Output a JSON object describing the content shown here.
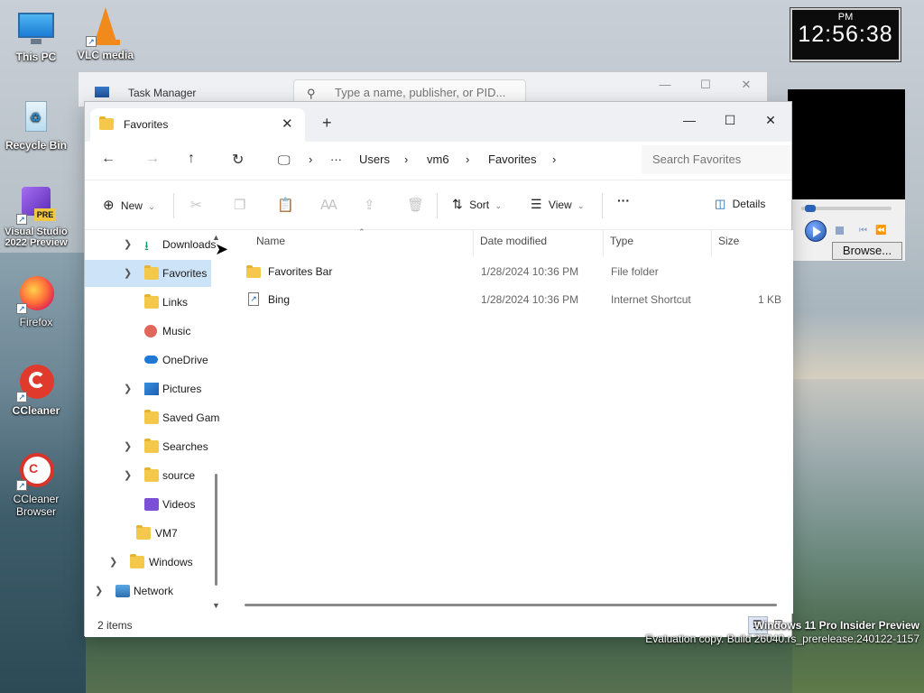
{
  "desktop": {
    "icons": [
      {
        "label": "This PC"
      },
      {
        "label": "VLC media"
      },
      {
        "label": "Recycle Bin"
      },
      {
        "label": "Visual Studio 2022 Preview"
      },
      {
        "label": "Firefox"
      },
      {
        "label": "CCleaner"
      },
      {
        "label": "CCleaner Browser"
      }
    ],
    "clock": {
      "ampm": "PM",
      "time": "12:56:38"
    },
    "media_player": {
      "browse_label": "Browse..."
    },
    "watermark": {
      "line1": "Windows 11 Pro Insider Preview",
      "line2": "Evaluation copy. Build 26040.rs_prerelease.240122-1157"
    }
  },
  "task_manager": {
    "title": "Task Manager",
    "search_placeholder": "Type a name, publisher, or PID..."
  },
  "explorer": {
    "tab": {
      "label": "Favorites"
    },
    "breadcrumb": [
      "Users",
      "vm6",
      "Favorites"
    ],
    "search_placeholder": "Search Favorites",
    "toolbar": {
      "new_label": "New",
      "sort_label": "Sort",
      "view_label": "View",
      "details_label": "Details"
    },
    "nav_tree": [
      {
        "label": "Downloads",
        "icon": "download-icon",
        "chevron": true
      },
      {
        "label": "Favorites",
        "icon": "folder-icon",
        "chevron": true,
        "selected": true
      },
      {
        "label": "Links",
        "icon": "folder-icon",
        "chevron": false
      },
      {
        "label": "Music",
        "icon": "music-icon",
        "chevron": false
      },
      {
        "label": "OneDrive",
        "icon": "cloud-icon",
        "chevron": false
      },
      {
        "label": "Pictures",
        "icon": "pictures-icon",
        "chevron": true
      },
      {
        "label": "Saved Games",
        "icon": "folder-icon",
        "chevron": false
      },
      {
        "label": "Searches",
        "icon": "folder-icon",
        "chevron": true
      },
      {
        "label": "source",
        "icon": "folder-icon",
        "chevron": true
      },
      {
        "label": "Videos",
        "icon": "videos-icon",
        "chevron": false
      },
      {
        "label": "VM7",
        "icon": "folder-icon",
        "chevron": false
      },
      {
        "label": "Windows",
        "icon": "folder-icon",
        "chevron": true
      },
      {
        "label": "Network",
        "icon": "network-icon",
        "chevron": true
      }
    ],
    "columns": {
      "name": "Name",
      "date": "Date modified",
      "type": "Type",
      "size": "Size"
    },
    "files": [
      {
        "name": "Favorites Bar",
        "date": "1/28/2024 10:36 PM",
        "type": "File folder",
        "size": ""
      },
      {
        "name": "Bing",
        "date": "1/28/2024 10:36 PM",
        "type": "Internet Shortcut",
        "size": "1 KB"
      }
    ],
    "status": {
      "count": "2 items"
    }
  }
}
